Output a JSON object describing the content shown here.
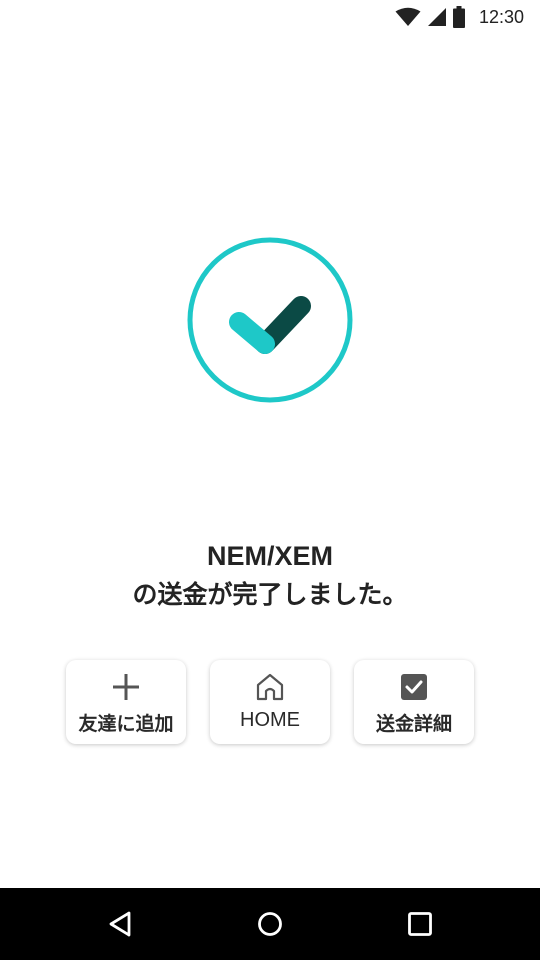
{
  "status_bar": {
    "time": "12:30",
    "icons": [
      "wifi-icon",
      "cell-signal-icon",
      "battery-icon"
    ]
  },
  "success": {
    "icon": "check-circle-icon",
    "ring_color": "#1ec8c8",
    "check_light_color": "#1ec8c8",
    "check_dark_color": "#0b4a45"
  },
  "message": {
    "line1": "NEM/XEM",
    "line2": "の送金が完了しました。"
  },
  "actions": {
    "add_friend": {
      "label": "友達に追加",
      "icon": "plus-icon"
    },
    "home": {
      "label": "HOME",
      "icon": "home-icon"
    },
    "details": {
      "label": "送金詳細",
      "icon": "checkbox-icon"
    }
  },
  "nav": {
    "back_icon": "back-triangle-icon",
    "home_icon": "home-circle-icon",
    "recents_icon": "recents-square-icon"
  }
}
